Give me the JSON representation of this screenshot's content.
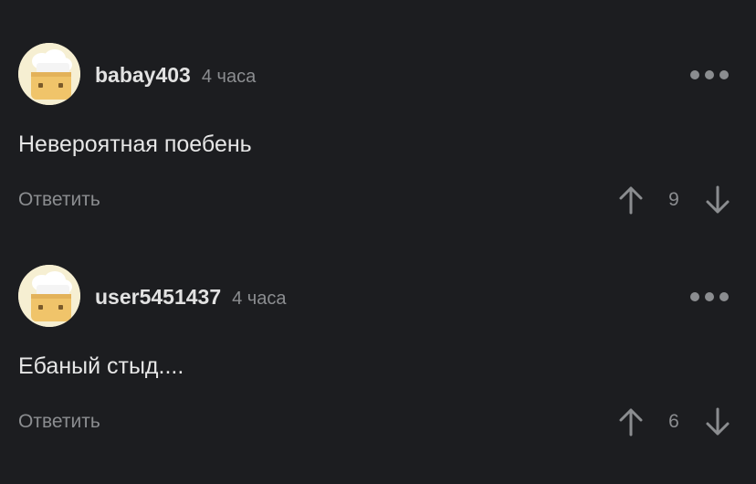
{
  "colors": {
    "background": "#1c1d20",
    "username": "#e2e2e2",
    "muted": "#8b8d90",
    "text": "#e6e6e6",
    "avatar_bg": "#f6efd2",
    "avatar_face": "#f0c46a"
  },
  "icons": {
    "avatar": "chef-avatar-icon",
    "more": "more-horizontal-icon",
    "upvote": "arrow-up-icon",
    "downvote": "arrow-down-icon"
  },
  "comments": [
    {
      "username": "babay403",
      "time": "4 часа",
      "text": "Невероятная поебень",
      "reply_label": "Ответить",
      "score": "9"
    },
    {
      "username": "user5451437",
      "time": "4 часа",
      "text": "Ебаный стыд....",
      "reply_label": "Ответить",
      "score": "6"
    }
  ]
}
